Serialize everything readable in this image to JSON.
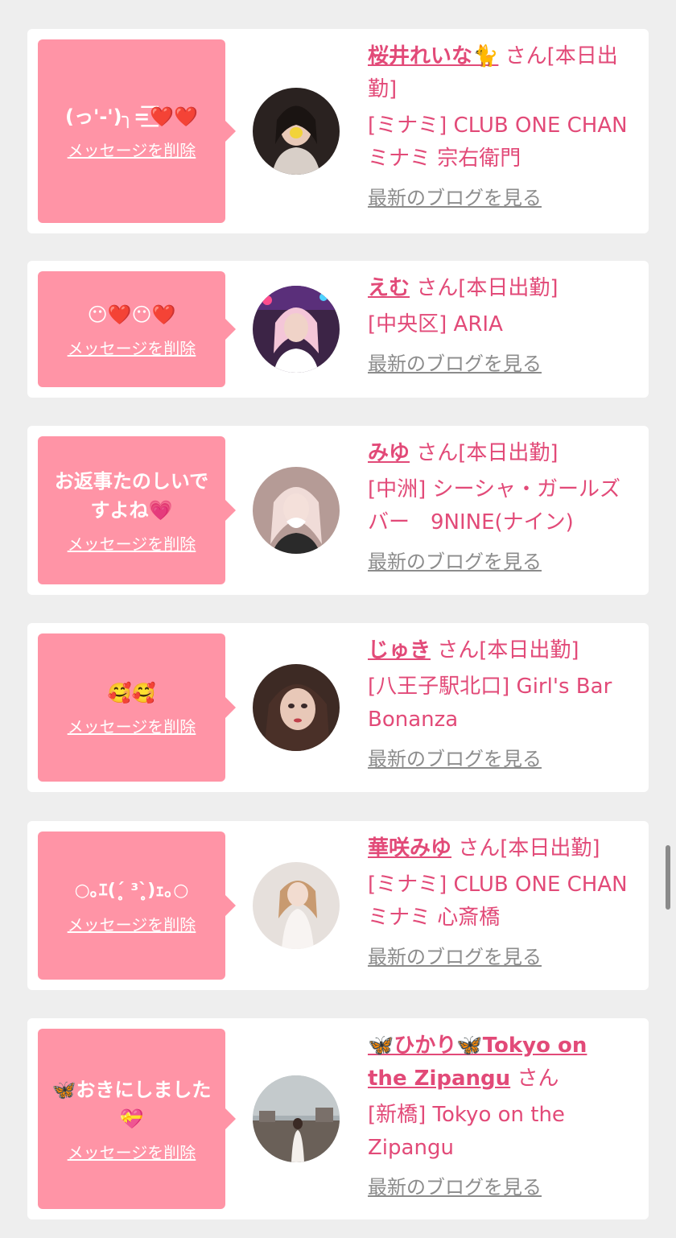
{
  "delete_label": "メッセージを削除",
  "blog_label": "最新のブログを見る",
  "items": [
    {
      "message": "(っ'-')╮=͟͟͞͞❤️❤️",
      "name": "桜井れいな🐈",
      "suffix": " さん[本日出勤]",
      "shop": "[ミナミ] CLUB ONE CHAN ミナミ 宗右衛門",
      "avatar_color": "#3a2f2c"
    },
    {
      "message": "😶❤️😶❤️",
      "name": "えむ",
      "suffix": " さん[本日出勤]",
      "shop": "[中央区] ARIA",
      "avatar_color": "#6a3d6e"
    },
    {
      "message": "お返事たのしいですよね💗",
      "name": "みゆ",
      "suffix": " さん[本日出勤]",
      "shop": "[中洲] シーシャ・ガールズバー　9NINE(ナイン)",
      "avatar_color": "#c8a8a2"
    },
    {
      "message": "🥰🥰",
      "name": "じゅき",
      "suffix": " さん[本日出勤]",
      "shop": "[八王子駅北口] Girl's Bar Bonanza",
      "avatar_color": "#5a3e36"
    },
    {
      "message": "○｡ｴ(ˊ̥̥̥̥̥ ³ˋ̥̥̥̥̥)ｪ｡○",
      "name": "華咲みゆ",
      "suffix": " さん[本日出勤]",
      "shop": "[ミナミ] CLUB ONE CHAN ミナミ 心斎橋",
      "avatar_color": "#ded7d2"
    },
    {
      "message": "🦋おきにしました💝",
      "name": "🦋ひかり🦋Tokyo on the Zipangu",
      "suffix": " さん",
      "shop": "[新橋] Tokyo on the Zipangu",
      "avatar_color": "#9aa0a2"
    }
  ]
}
